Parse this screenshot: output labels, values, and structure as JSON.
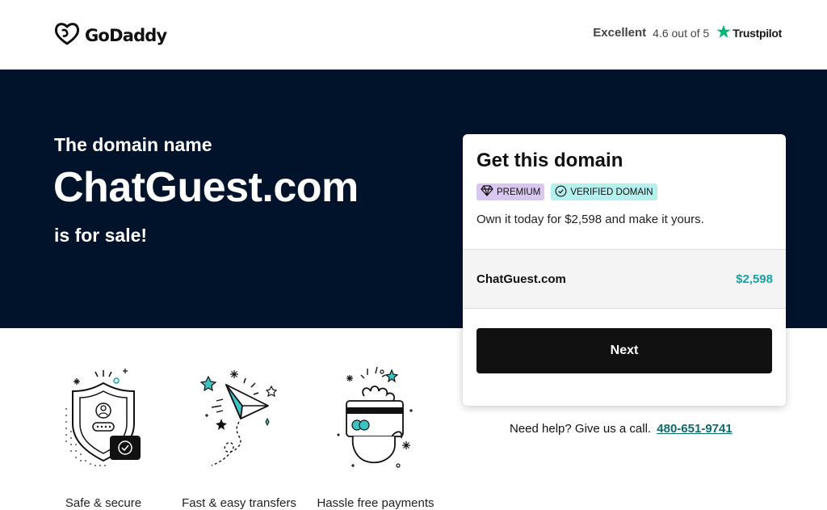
{
  "header": {
    "brand": "GoDaddy",
    "trust": {
      "excellent": "Excellent",
      "rating": "4.6 out of 5",
      "provider": "Trustpilot",
      "star_color": "#00b67a"
    }
  },
  "hero": {
    "pre": "The domain name",
    "domain": "ChatGuest.com",
    "post": "is for sale!",
    "background": "#00132b"
  },
  "card": {
    "title": "Get this domain",
    "badges": [
      {
        "label": "PREMIUM",
        "icon": "diamond-icon",
        "color": "#d9c7f2"
      },
      {
        "label": "VERIFIED DOMAIN",
        "icon": "check-circle-icon",
        "color": "#b4f0ee"
      }
    ],
    "description": "Own it today for $2,598 and make it yours.",
    "domain": "ChatGuest.com",
    "price": "$2,598",
    "price_color": "#17a2a4",
    "next_label": "Next"
  },
  "help": {
    "text": "Need help? Give us a call.",
    "phone": "480-651-9741"
  },
  "features": [
    {
      "label": "Safe & secure",
      "icon": "shield-icon"
    },
    {
      "label": "Fast & easy transfers",
      "icon": "paper-plane-icon"
    },
    {
      "label": "Hassle free payments",
      "icon": "credit-card-hand-icon"
    }
  ]
}
